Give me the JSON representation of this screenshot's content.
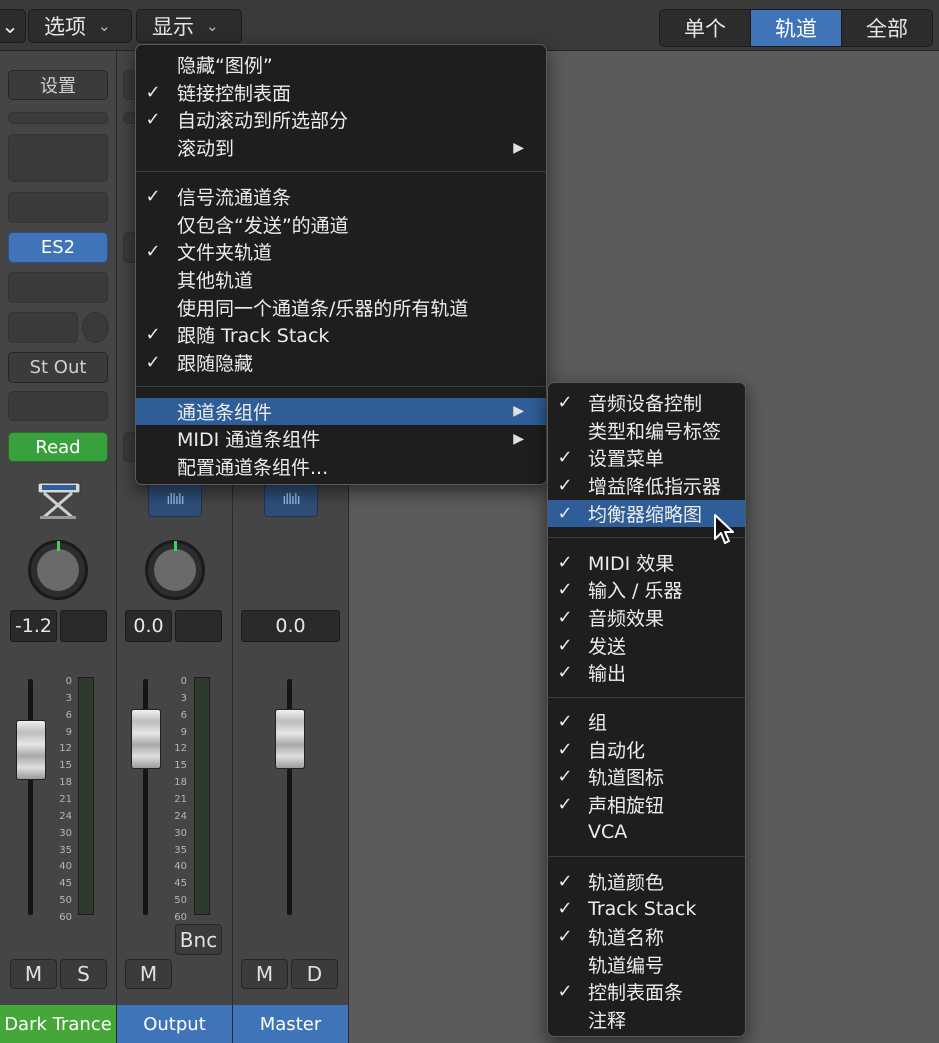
{
  "toolbar": {
    "left_chevron": "⌄",
    "options_label": "选项",
    "display_label": "显示",
    "chevron": "⌄",
    "view_segments": [
      "单个",
      "轨道",
      "全部"
    ],
    "active_segment": "轨道"
  },
  "strips": [
    {
      "setting_label": "设置",
      "instrument_label": "ES2",
      "output_label": "St Out",
      "automation_label": "Read",
      "volume": "-1.2",
      "name": "Dark Trance",
      "buttons": [
        "M",
        "S"
      ],
      "name_color": "#45a63a"
    },
    {
      "volume": "0.0",
      "name": "Output",
      "bounce_label": "Bnc",
      "buttons": [
        "M"
      ],
      "name_color": "#3f74b8"
    },
    {
      "volume": "0.0",
      "name": "Master",
      "buttons": [
        "M",
        "D"
      ],
      "name_color": "#3f74b8"
    }
  ],
  "fader_scale": [
    "0",
    "3",
    "6",
    "9",
    "12",
    "15",
    "18",
    "21",
    "24",
    "30",
    "35",
    "40",
    "45",
    "50",
    "60"
  ],
  "display_menu": {
    "sections": [
      [
        {
          "label": "隐藏“图例”",
          "checked": false
        },
        {
          "label": "链接控制表面",
          "checked": true
        },
        {
          "label": "自动滚动到所选部分",
          "checked": true
        },
        {
          "label": "滚动到",
          "checked": false,
          "submenu": true
        }
      ],
      [
        {
          "label": "信号流通道条",
          "checked": true
        },
        {
          "label": "仅包含“发送”的通道",
          "checked": false
        },
        {
          "label": "文件夹轨道",
          "checked": true
        },
        {
          "label": "其他轨道",
          "checked": false
        },
        {
          "label": "使用同一个通道条/乐器的所有轨道",
          "checked": false
        },
        {
          "label": "跟随 Track Stack",
          "checked": true
        },
        {
          "label": "跟随隐藏",
          "checked": true
        }
      ],
      [
        {
          "label": "通道条组件",
          "checked": false,
          "submenu": true,
          "highlighted": true
        },
        {
          "label": "MIDI 通道条组件",
          "checked": false,
          "submenu": true
        },
        {
          "label": "配置通道条组件...",
          "checked": false
        }
      ]
    ]
  },
  "components_menu": {
    "sections": [
      [
        {
          "label": "音频设备控制",
          "checked": true
        },
        {
          "label": "类型和编号标签",
          "checked": false
        },
        {
          "label": "设置菜单",
          "checked": true
        },
        {
          "label": "增益降低指示器",
          "checked": true
        },
        {
          "label": "均衡器缩略图",
          "checked": true,
          "highlighted": true
        }
      ],
      [
        {
          "label": "MIDI 效果",
          "checked": true
        },
        {
          "label": "输入 / 乐器",
          "checked": true
        },
        {
          "label": "音频效果",
          "checked": true
        },
        {
          "label": "发送",
          "checked": true
        },
        {
          "label": "输出",
          "checked": true
        }
      ],
      [
        {
          "label": "组",
          "checked": true
        },
        {
          "label": "自动化",
          "checked": true
        },
        {
          "label": "轨道图标",
          "checked": true
        },
        {
          "label": "声相旋钮",
          "checked": true
        },
        {
          "label": "VCA",
          "checked": false
        }
      ],
      [
        {
          "label": "轨道颜色",
          "checked": true
        },
        {
          "label": "Track Stack",
          "checked": true
        },
        {
          "label": "轨道名称",
          "checked": true
        },
        {
          "label": "轨道编号",
          "checked": false
        },
        {
          "label": "控制表面条",
          "checked": true
        },
        {
          "label": "注释",
          "checked": false
        }
      ]
    ]
  },
  "icons": {
    "check": "✓",
    "submenu_arrow": "▶",
    "waveform": "ıllılı",
    "keyboard": "keyboard-stand-icon"
  }
}
